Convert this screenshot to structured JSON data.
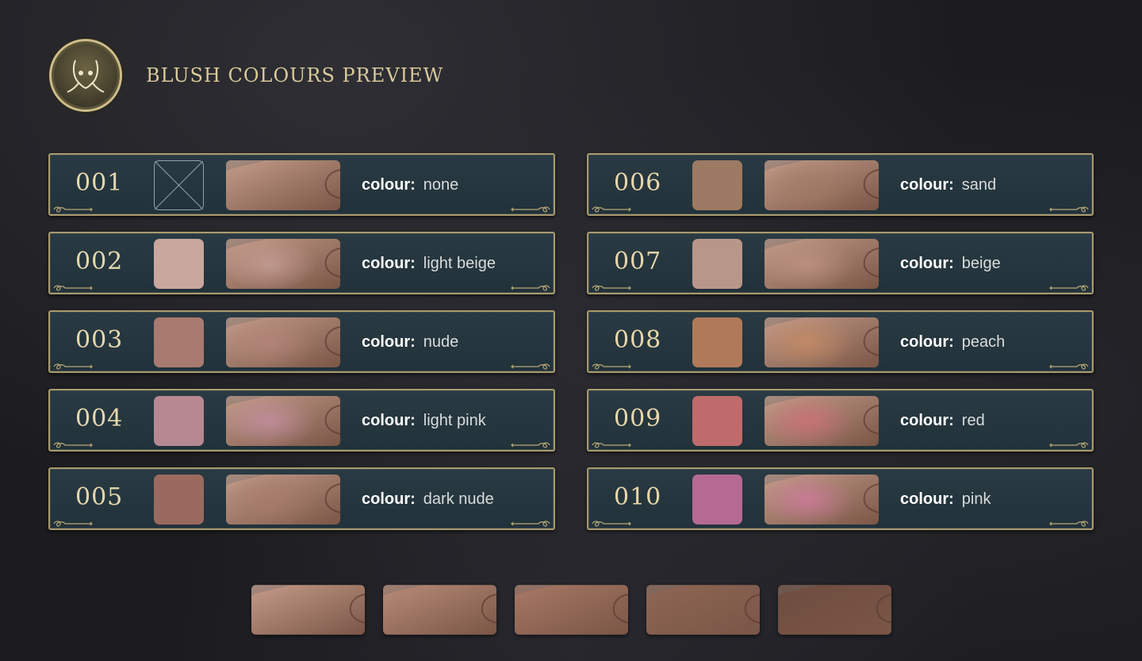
{
  "header": {
    "title": "BLUSH COLOURS PREVIEW",
    "emblem_icon": "face-icon"
  },
  "label_key": "colour:",
  "items": [
    {
      "code": "001",
      "colour": "none",
      "swatch": "none",
      "blush": "none"
    },
    {
      "code": "006",
      "colour": "sand",
      "swatch": "#9c7a63",
      "blush": "#a07a62"
    },
    {
      "code": "002",
      "colour": "light beige",
      "swatch": "#c9a69e",
      "blush": "#caa29a"
    },
    {
      "code": "007",
      "colour": "beige",
      "swatch": "#b8978a",
      "blush": "#c09486"
    },
    {
      "code": "003",
      "colour": "nude",
      "swatch": "#a87a70",
      "blush": "#b5857a"
    },
    {
      "code": "008",
      "colour": "peach",
      "swatch": "#b07a5a",
      "blush": "#c98c62"
    },
    {
      "code": "004",
      "colour": "light pink",
      "swatch": "#b68892",
      "blush": "#c690a6"
    },
    {
      "code": "009",
      "colour": "red",
      "swatch": "#c06b6b",
      "blush": "#d26f78"
    },
    {
      "code": "005",
      "colour": "dark nude",
      "swatch": "#9b6a5e",
      "blush": "#a77a6c"
    },
    {
      "code": "010",
      "colour": "pink",
      "swatch": "#b56a92",
      "blush": "#d27aa0"
    }
  ],
  "skin_tones": [
    "#c59b8a",
    "#b88b78",
    "#a87865",
    "#8e6655",
    "#6e4c40"
  ]
}
